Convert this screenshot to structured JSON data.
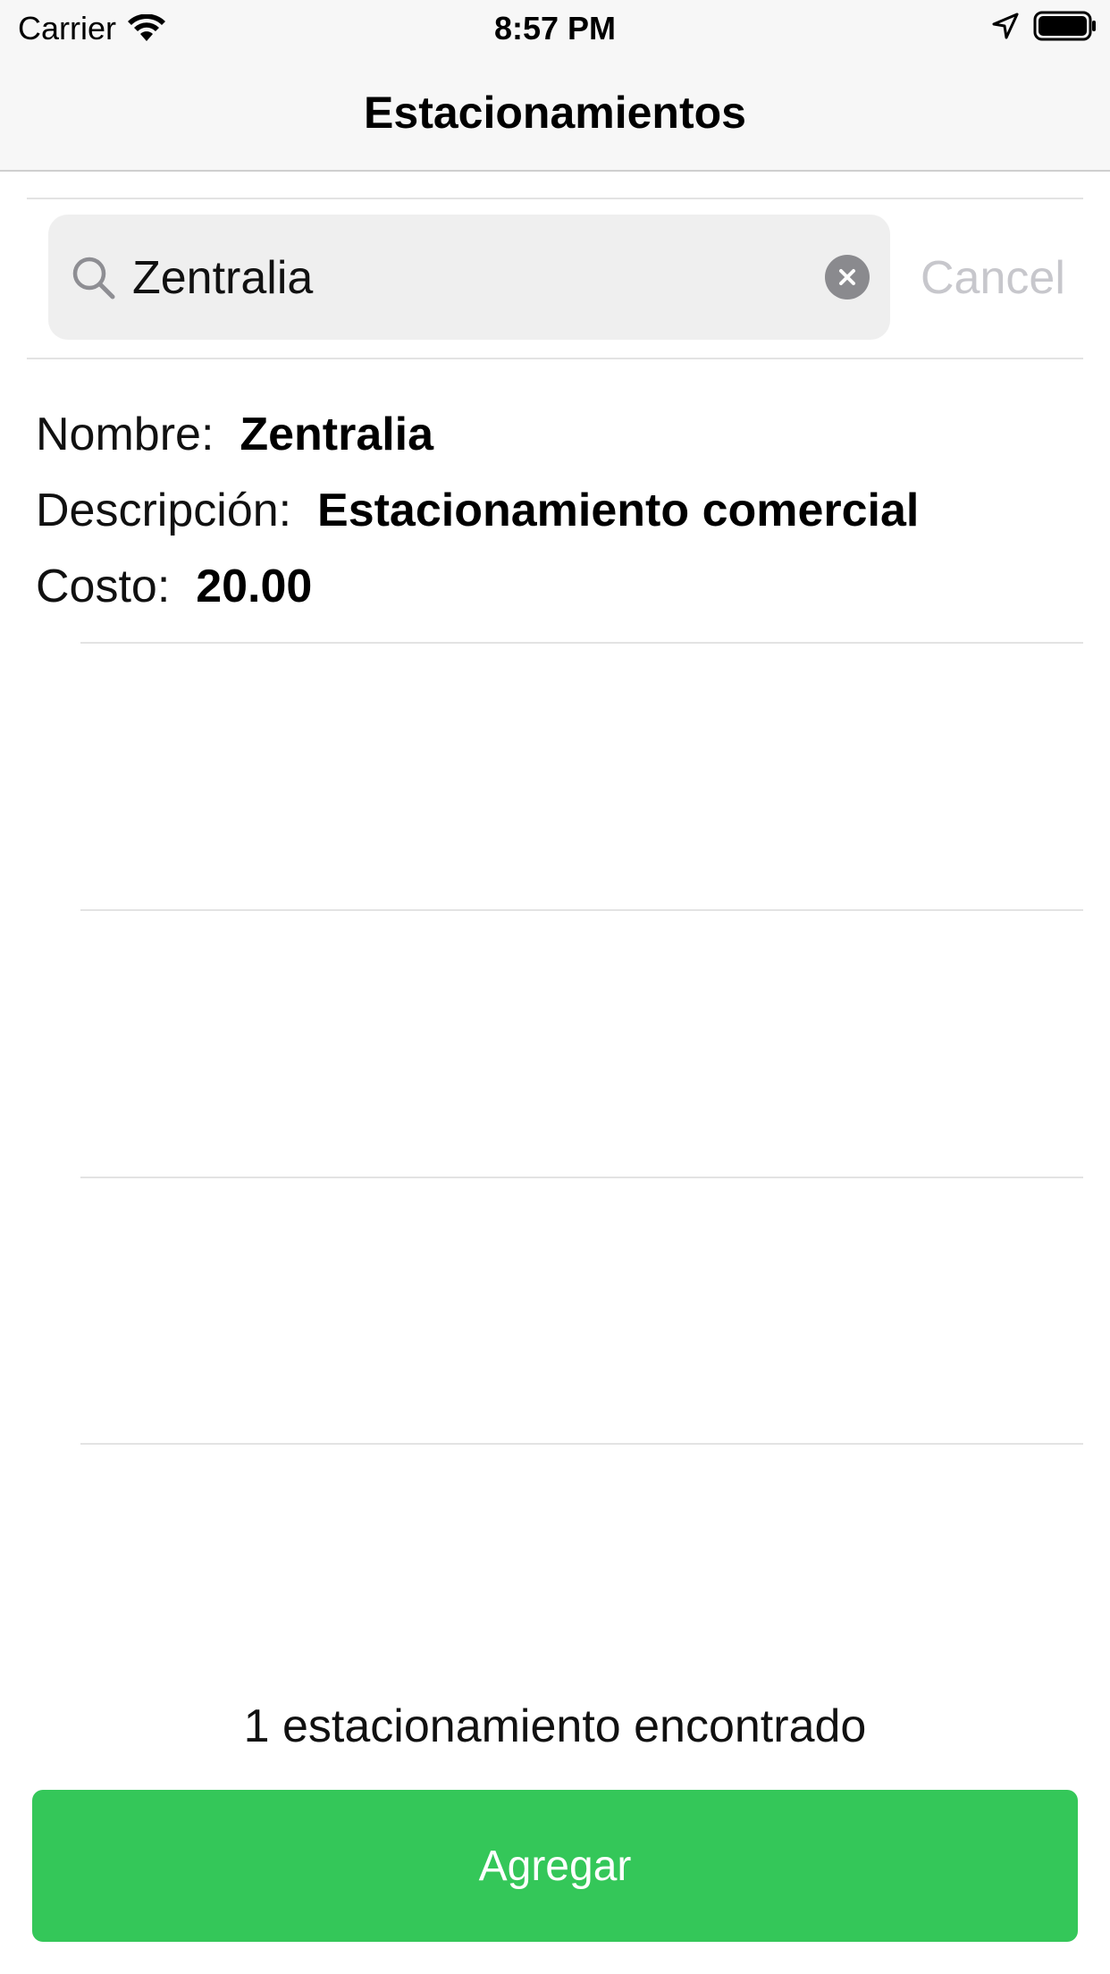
{
  "status_bar": {
    "carrier": "Carrier",
    "time": "8:57 PM",
    "icons": [
      "wifi-icon",
      "location-arrow-icon",
      "battery-icon"
    ]
  },
  "nav": {
    "title": "Estacionamientos"
  },
  "search": {
    "value": "Zentralia",
    "cancel_label": "Cancel",
    "icons": [
      "search-icon",
      "clear-icon"
    ]
  },
  "result": {
    "name_label": "Nombre:",
    "name_value": "Zentralia",
    "description_label": "Descripción:",
    "description_value": "Estacionamiento comercial",
    "cost_label": "Costo:",
    "cost_value": "20.00"
  },
  "footer": {
    "count_text": "1 estacionamiento encontrado",
    "add_label": "Agregar"
  },
  "colors": {
    "accent_green": "#34c759",
    "cancel_gray": "#c7c7cc",
    "header_bg": "#f7f7f7",
    "search_bg": "#efefef"
  }
}
